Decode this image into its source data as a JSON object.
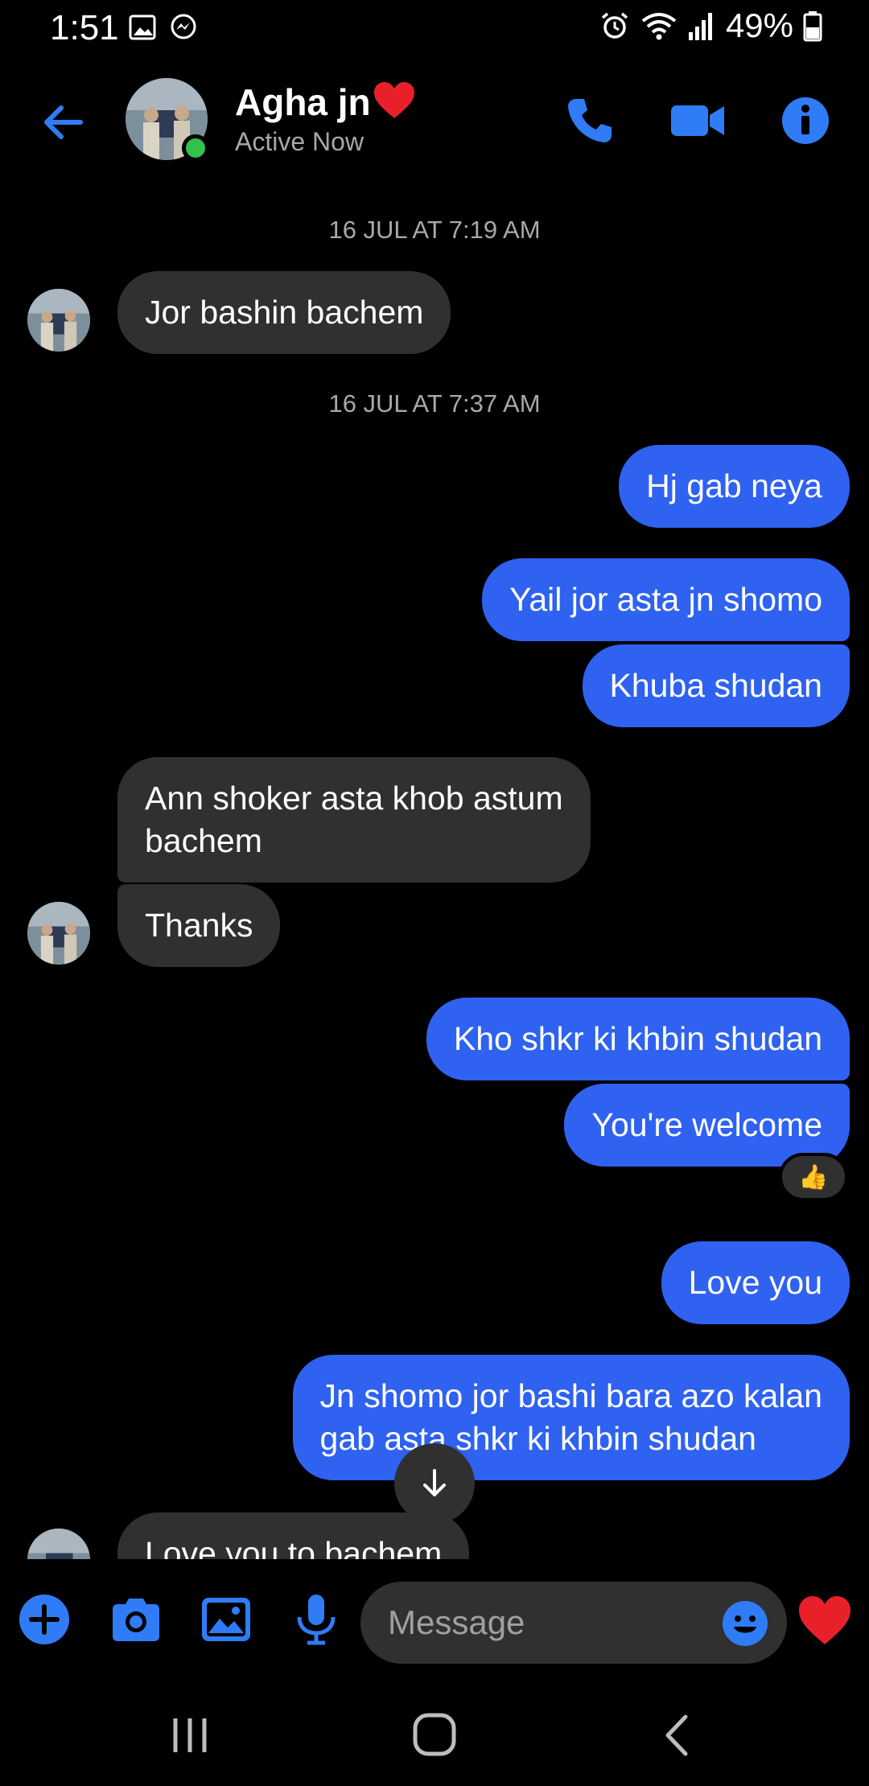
{
  "status_bar": {
    "time": "1:51",
    "battery": "49%"
  },
  "header": {
    "contact_name": "Agha jn",
    "contact_status": "Active Now"
  },
  "timestamps": [
    "16 JUL AT 7:19 AM",
    "16 JUL AT 7:37 AM"
  ],
  "messages": [
    {
      "dir": "in",
      "text": "Jor bashin bachem"
    },
    {
      "dir": "out",
      "text": "Hj gab neya"
    },
    {
      "dir": "out",
      "text": "Yail jor asta jn shomo"
    },
    {
      "dir": "out",
      "text": "Khuba shudan"
    },
    {
      "dir": "in",
      "line1": "Ann shoker asta  khob astum",
      "line2": "bachem"
    },
    {
      "dir": "in",
      "text": "Thanks"
    },
    {
      "dir": "out",
      "text": "Kho shkr ki khbin shudan"
    },
    {
      "dir": "out",
      "text": "You're welcome",
      "reaction": "👍"
    },
    {
      "dir": "out",
      "text": "Love you"
    },
    {
      "dir": "out",
      "line1": "Jn shomo jor bashi bara azo kalan",
      "line2": "gab asta shkr ki khbin shudan"
    },
    {
      "dir": "in",
      "text": "Love you to bachem"
    }
  ],
  "composer": {
    "placeholder": "Message"
  },
  "colors": {
    "accent": "#2f62f0",
    "incoming_bubble": "#303030",
    "online": "#31c24e",
    "heart": "#e8202a"
  }
}
